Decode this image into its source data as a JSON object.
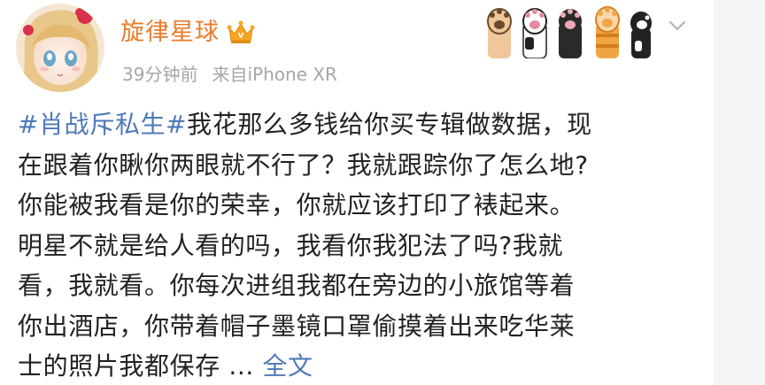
{
  "user": {
    "name": "旋律星球",
    "vip_badge_icon": "vip-crown-icon"
  },
  "meta": {
    "time": "39分钟前",
    "source_prefix": "来自",
    "device": "iPhone XR"
  },
  "decorations": {
    "icons": [
      "cat-paw-icon",
      "cat-paw-icon",
      "cat-paw-icon",
      "cat-paw-icon",
      "cat-paw-icon"
    ],
    "menu_icon": "chevron-down-icon"
  },
  "post": {
    "hashtag": "#肖战斥私生#",
    "lines": [
      "我花那么多钱给你买专辑做数据，现",
      "在跟着你瞅你两眼就不行了？我就跟踪你了怎么地?",
      "你能被我看是你的荣幸，你就应该打印了裱起来。",
      "明星不就是给人看的吗，我看你我犯法了吗?我就",
      "看，我就看。你每次进组我都在旁边的小旅馆等着",
      "你出酒店，你带着帽子墨镜口罩偷摸着出来吃华莱",
      "士的照片我都保存"
    ],
    "ellipsis": " ...",
    "fulltext_label": "全文"
  },
  "colors": {
    "username": "#ea7b2c",
    "link": "#4e79b8",
    "meta": "#a6a6a6",
    "text": "#222222"
  }
}
